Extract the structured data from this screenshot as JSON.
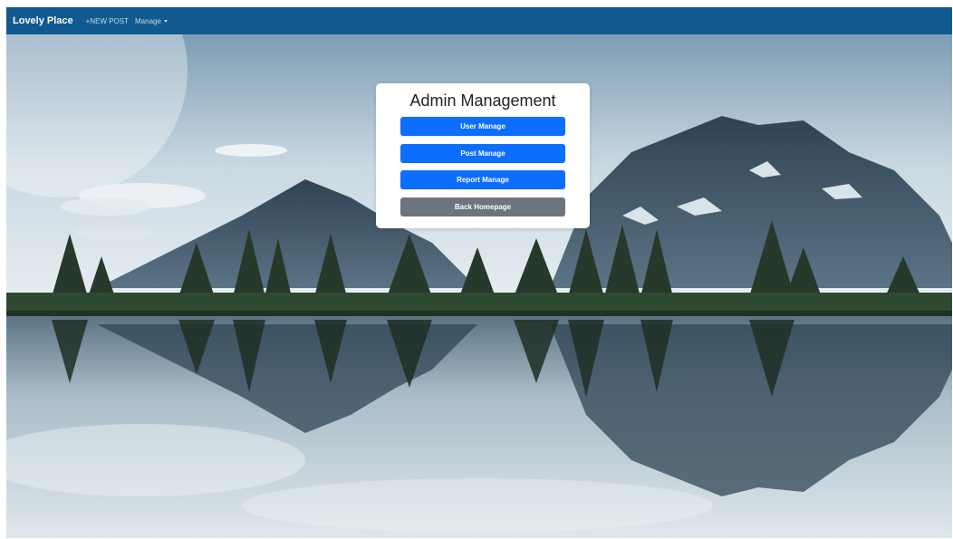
{
  "navbar": {
    "brand": "Lovely Place",
    "new_post": "+NEW POST",
    "manage": "Manage"
  },
  "admin_card": {
    "title": "Admin Management",
    "buttons": [
      {
        "label": "User Manage"
      },
      {
        "label": "Post Manage"
      },
      {
        "label": "Report Manage"
      },
      {
        "label": "Back Homepage"
      }
    ]
  },
  "colors": {
    "navbar_bg": "#115a8f",
    "primary_button": "#0d6efd",
    "secondary_button": "#6c757d",
    "card_bg": "#ffffff"
  },
  "background": {
    "icon": "mountain-lake-landscape"
  }
}
